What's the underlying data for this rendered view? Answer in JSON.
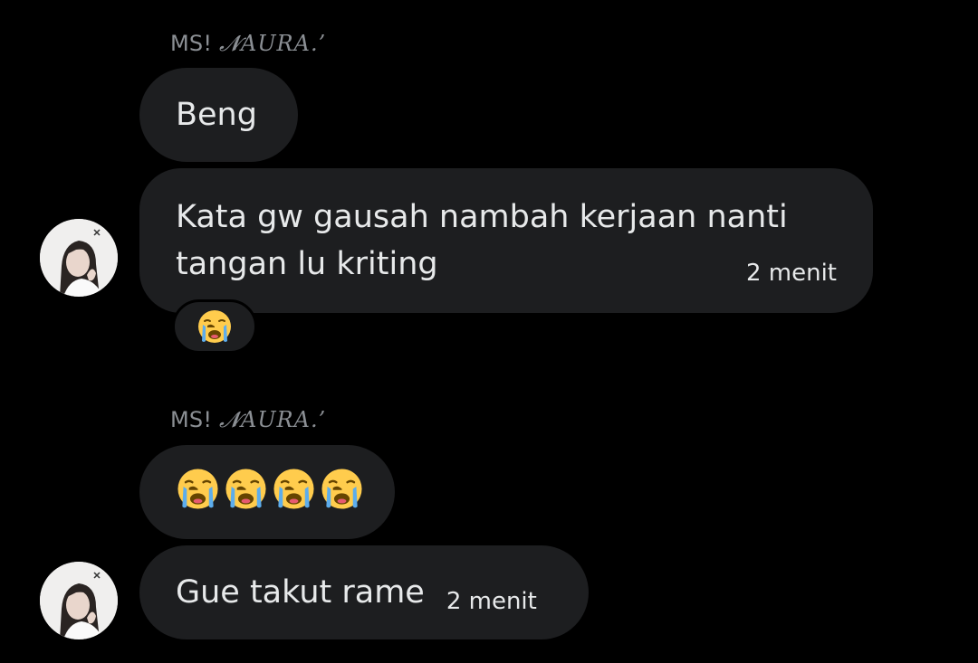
{
  "messages": [
    {
      "sender_plain": "MS! ",
      "sender_fancy": "𝓝𝐴𝑈𝑅𝐴.’"
    },
    {
      "text": "Beng"
    },
    {
      "line1": "Kata gw gausah nambah kerjaan nanti",
      "line2": "tangan lu kriting",
      "time": "2 menit",
      "reaction": "loudly-crying-face"
    },
    {
      "sender_plain": "MS! ",
      "sender_fancy": "𝓝𝐴𝑈𝑅𝐴.’"
    },
    {
      "emojis": [
        "loudly-crying-face",
        "loudly-crying-face",
        "loudly-crying-face",
        "loudly-crying-face"
      ]
    },
    {
      "text": "Gue takut rame",
      "time": "2 menit"
    }
  ],
  "colors": {
    "background": "#000000",
    "bubble": "#1d1e20",
    "text": "#e7e9ea",
    "sender": "#8b8f94"
  }
}
